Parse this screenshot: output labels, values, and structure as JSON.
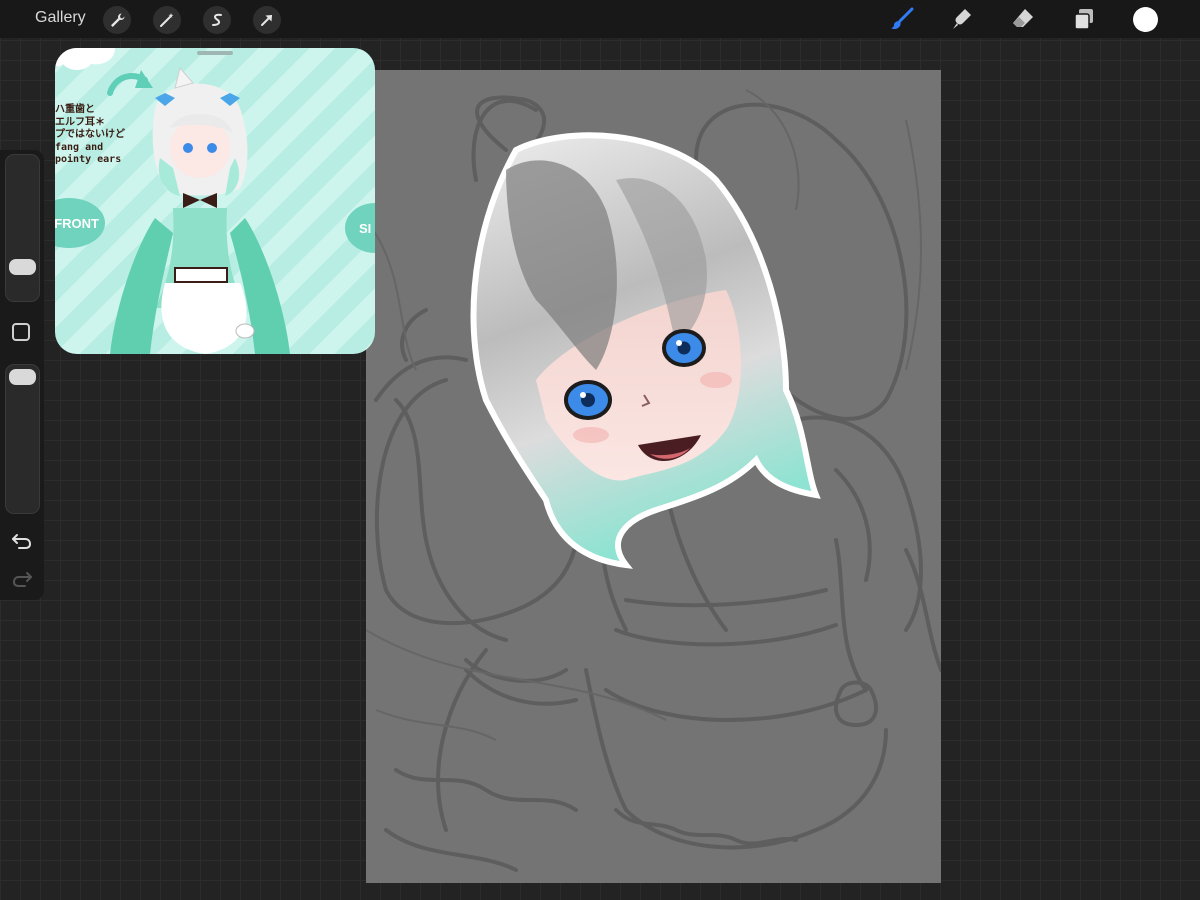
{
  "topbar": {
    "gallery_label": "Gallery",
    "actions": [
      "wrench-icon",
      "magic-wand-icon",
      "selection-icon",
      "transform-arrow-icon"
    ],
    "tools": [
      "brush-icon",
      "smudge-icon",
      "eraser-icon",
      "layers-icon"
    ],
    "active_tool": "brush",
    "active_color": "#ffffff",
    "brush_color": "#2f7cf6"
  },
  "sidebar": {
    "brush_size_level": 0.75,
    "opacity_level": 0.05
  },
  "reference": {
    "annotation_lines": "ハ重歯と\nエルフ耳＊\nプではないけど\nfang and\npointy ears",
    "front_label": "FRONT",
    "side_label": "SI"
  }
}
